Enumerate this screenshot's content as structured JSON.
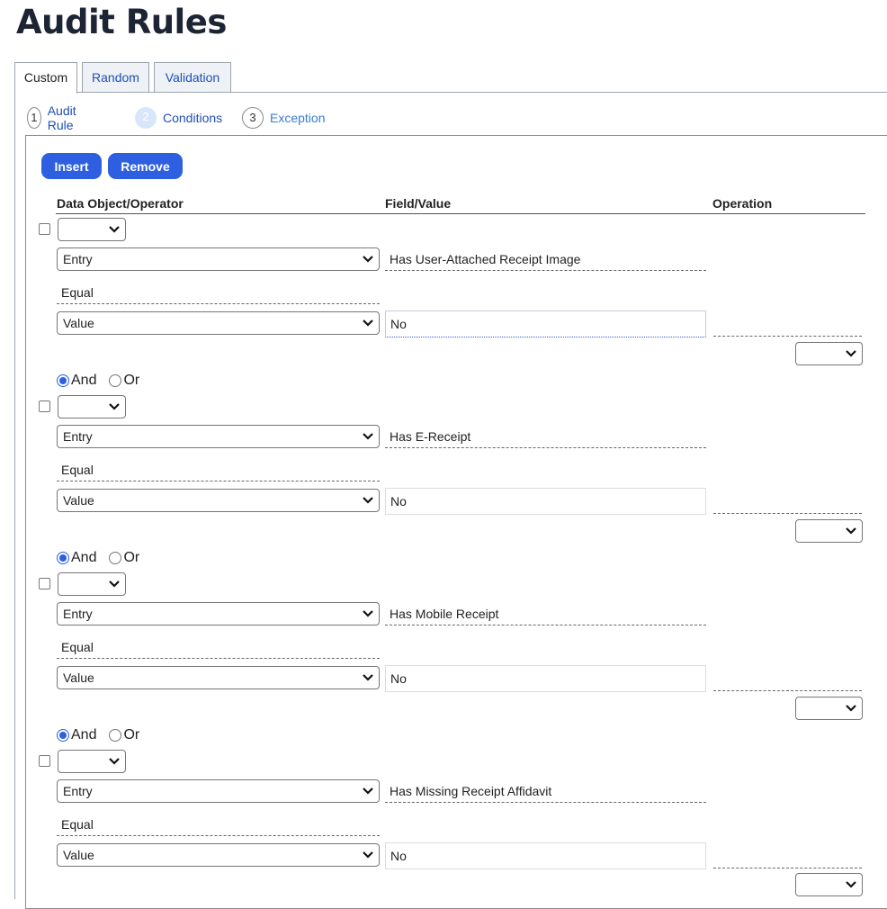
{
  "page": {
    "title": "Audit Rules"
  },
  "tabs": [
    {
      "label": "Custom",
      "active": true
    },
    {
      "label": "Random",
      "active": false
    },
    {
      "label": "Validation",
      "active": false
    }
  ],
  "steps": [
    {
      "number": "1",
      "label": "Audit Rule",
      "state": "done"
    },
    {
      "number": "2",
      "label": "Conditions",
      "state": "current"
    },
    {
      "number": "3",
      "label": "Exception",
      "state": "future"
    }
  ],
  "toolbar": {
    "insert_label": "Insert",
    "remove_label": "Remove"
  },
  "columns": {
    "data_object": "Data Object/Operator",
    "field_value": "Field/Value",
    "operation": "Operation"
  },
  "conditions": [
    {
      "entry_select": "Entry",
      "field": "Has User-Attached Receipt Image",
      "operator": "Equal",
      "value_select": "Value",
      "value": "No",
      "operation": ""
    },
    {
      "entry_select": "Entry",
      "field": "Has E-Receipt",
      "operator": "Equal",
      "value_select": "Value",
      "value": "No",
      "operation": ""
    },
    {
      "entry_select": "Entry",
      "field": "Has Mobile Receipt",
      "operator": "Equal",
      "value_select": "Value",
      "value": "No",
      "operation": ""
    },
    {
      "entry_select": "Entry",
      "field": "Has Missing Receipt Affidavit",
      "operator": "Equal",
      "value_select": "Value",
      "value": "No",
      "operation": ""
    }
  ],
  "connectors": [
    {
      "and_label": "And",
      "or_label": "Or",
      "selected": "And"
    },
    {
      "and_label": "And",
      "or_label": "Or",
      "selected": "And"
    },
    {
      "and_label": "And",
      "or_label": "Or",
      "selected": "And"
    }
  ],
  "colors": {
    "primary_button": "#2d5fe0",
    "link": "#1f4fb8",
    "title": "#1d2433"
  }
}
